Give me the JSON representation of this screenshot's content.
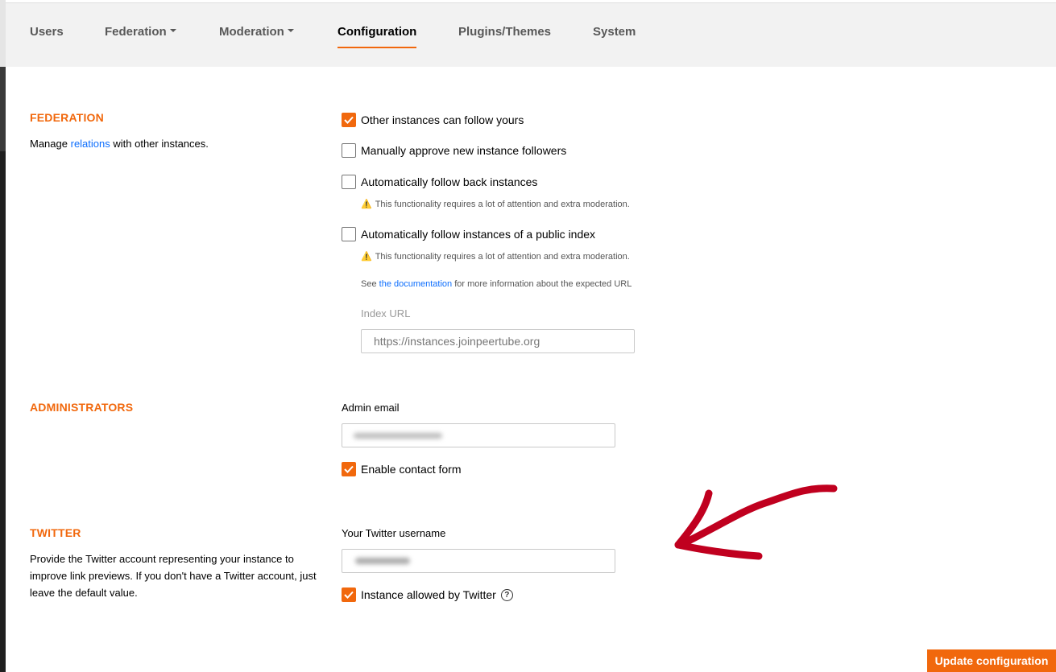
{
  "tabs": [
    {
      "label": "Users",
      "dropdown": false
    },
    {
      "label": "Federation",
      "dropdown": true
    },
    {
      "label": "Moderation",
      "dropdown": true
    },
    {
      "label": "Configuration",
      "dropdown": false,
      "active": true
    },
    {
      "label": "Plugins/Themes",
      "dropdown": false
    },
    {
      "label": "System",
      "dropdown": false
    }
  ],
  "federation": {
    "title": "FEDERATION",
    "desc_prefix": "Manage",
    "desc_link": "relations",
    "desc_suffix": "with other instances.",
    "options": [
      {
        "label": "Other instances can follow yours",
        "checked": true
      },
      {
        "label": "Manually approve new instance followers",
        "checked": false
      },
      {
        "label": "Automatically follow back instances",
        "checked": false
      },
      {
        "label": "Automatically follow instances of a public index",
        "checked": false
      }
    ],
    "warning": "This functionality requires a lot of attention and extra moderation.",
    "doc_prefix": "See",
    "doc_link": "the documentation",
    "doc_suffix": "for more information about the expected URL",
    "index_url_label": "Index URL",
    "index_url_placeholder": "https://instances.joinpeertube.org"
  },
  "administrators": {
    "title": "ADMINISTRATORS",
    "admin_email_label": "Admin email",
    "contact_form_label": "Enable contact form",
    "contact_form_checked": true
  },
  "twitter": {
    "title": "TWITTER",
    "desc": "Provide the Twitter account representing your instance to improve link previews. If you don't have a Twitter account, just leave the default value.",
    "username_label": "Your Twitter username",
    "allowed_label": "Instance allowed by Twitter",
    "allowed_checked": true,
    "help_symbol": "?"
  },
  "submit_label": "Update configuration",
  "colors": {
    "accent": "#f1680d",
    "link": "#0d6efd",
    "annotation": "#c0001f"
  },
  "icons": {
    "warning": "warning-icon",
    "check": "check-icon",
    "help": "help-icon",
    "caret": "caret-down-icon"
  }
}
